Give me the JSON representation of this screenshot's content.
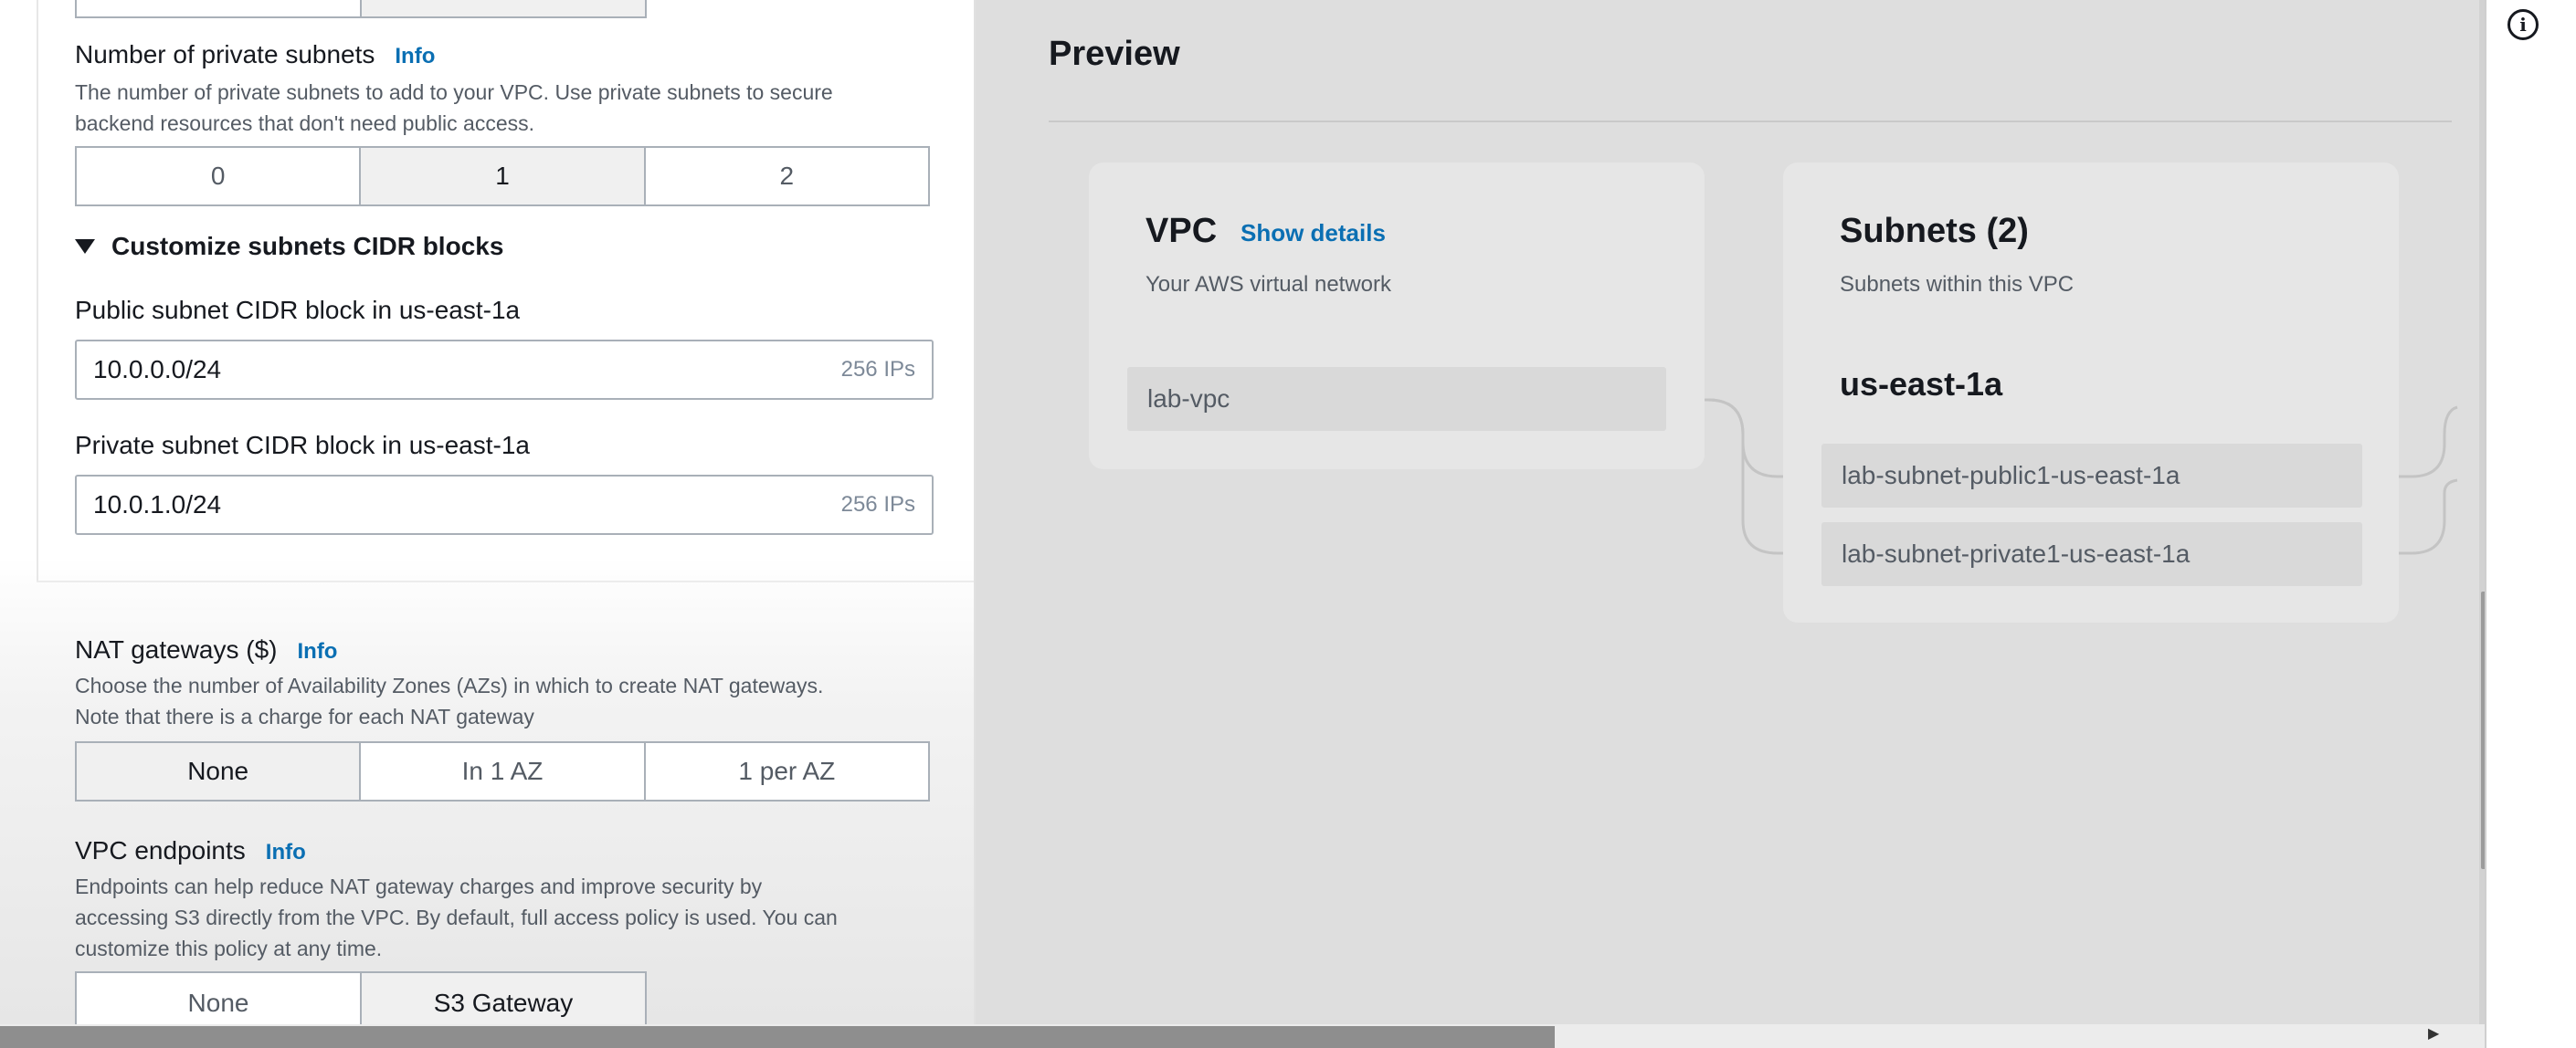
{
  "private_subnets": {
    "label": "Number of private subnets",
    "info": "Info",
    "description_line1": "The number of private subnets to add to your VPC. Use private subnets to secure",
    "description_line2": "backend resources that don't need public access.",
    "options": [
      "0",
      "1",
      "2"
    ],
    "selected": "1"
  },
  "customize": {
    "label": "Customize subnets CIDR blocks",
    "public_label": "Public subnet CIDR block in us-east-1a",
    "public_value": "10.0.0.0/24",
    "public_hint": "256 IPs",
    "private_label": "Private subnet CIDR block in us-east-1a",
    "private_value": "10.0.1.0/24",
    "private_hint": "256 IPs"
  },
  "nat": {
    "label": "NAT gateways ($)",
    "info": "Info",
    "description_line1": "Choose the number of Availability Zones (AZs) in which to create NAT gateways.",
    "description_line2": "Note that there is a charge for each NAT gateway",
    "options": [
      "None",
      "In 1 AZ",
      "1 per AZ"
    ],
    "selected": "None"
  },
  "endpoints": {
    "label": "VPC endpoints",
    "info": "Info",
    "description_line1": "Endpoints can help reduce NAT gateway charges and improve security by",
    "description_line2": "accessing S3 directly from the VPC. By default, full access policy is used. You can",
    "description_line3": "customize this policy at any time.",
    "options": [
      "None",
      "S3 Gateway"
    ],
    "selected": "S3 Gateway"
  },
  "preview": {
    "title": "Preview",
    "vpc": {
      "title": "VPC",
      "show_details": "Show details",
      "subtitle": "Your AWS virtual network",
      "name": "lab-vpc"
    },
    "subnets": {
      "title": "Subnets (2)",
      "subtitle": "Subnets within this VPC",
      "az": "us-east-1a",
      "items": [
        "lab-subnet-public1-us-east-1a",
        "lab-subnet-private1-us-east-1a"
      ]
    }
  },
  "icons": {
    "info": "info-circle-icon",
    "caret": "caret-down-icon"
  }
}
